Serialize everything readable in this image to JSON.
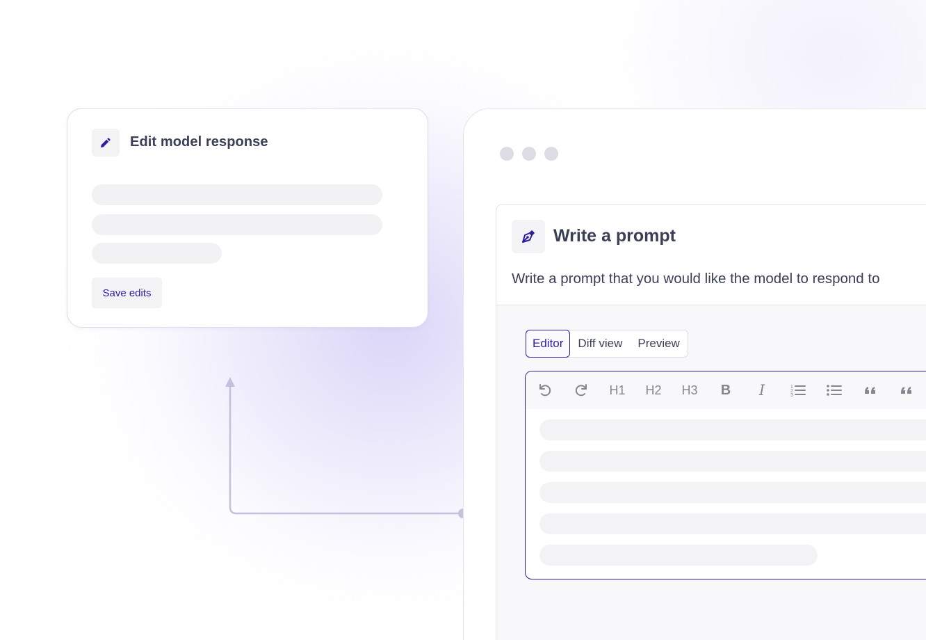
{
  "edit_card": {
    "title": "Edit model response",
    "icon": "pencil-icon",
    "save_label": "Save edits"
  },
  "window": {
    "traffic_lights": 3,
    "prompt": {
      "icon": "pen-nib-icon",
      "title": "Write a prompt",
      "description": "Write a prompt that you would like the model to respond to"
    },
    "tabs": [
      {
        "label": "Editor",
        "active": true
      },
      {
        "label": "Diff view",
        "active": false
      },
      {
        "label": "Preview",
        "active": false
      }
    ],
    "toolbar": [
      {
        "name": "undo-icon",
        "label": ""
      },
      {
        "name": "redo-icon",
        "label": ""
      },
      {
        "name": "heading-1-button",
        "label": "H1"
      },
      {
        "name": "heading-2-button",
        "label": "H2"
      },
      {
        "name": "heading-3-button",
        "label": "H3"
      },
      {
        "name": "bold-button",
        "label": "B"
      },
      {
        "name": "italic-button",
        "label": "I"
      },
      {
        "name": "ordered-list-icon",
        "label": ""
      },
      {
        "name": "bullet-list-icon",
        "label": ""
      },
      {
        "name": "quote-icon",
        "label": ""
      },
      {
        "name": "quote-icon",
        "label": ""
      }
    ]
  },
  "colors": {
    "accent": "#2a1ea0",
    "text": "#3a3f56",
    "skeleton": "#f2f2f4",
    "connector": "#bcbad4"
  }
}
